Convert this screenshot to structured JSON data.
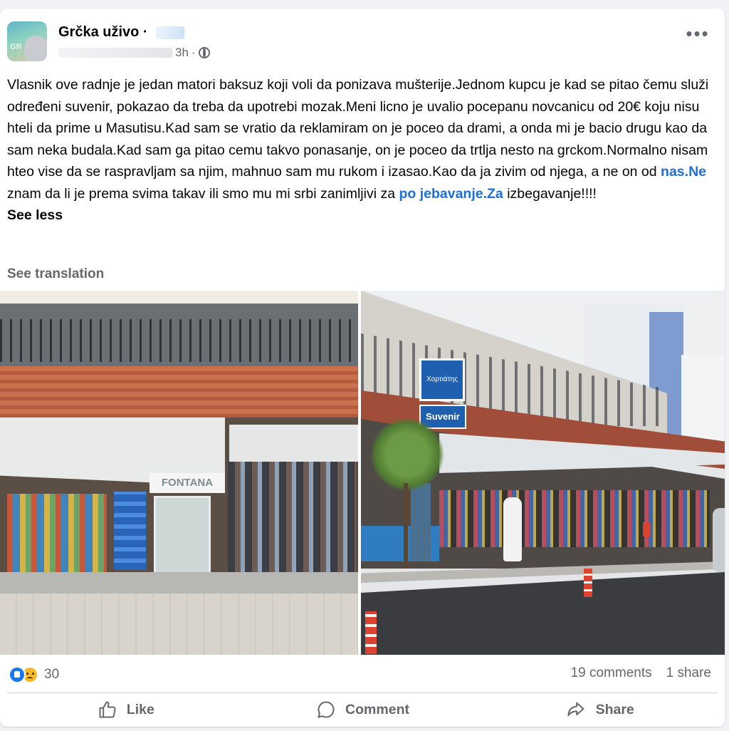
{
  "post": {
    "page_name": "Grčka uživo ·",
    "avatar_text": "GR",
    "time": "3h",
    "dot": "·",
    "more": "•••",
    "text_parts": {
      "p1": "Vlasnik ove radnje je jedan matori baksuz koji voli da ponizava mušterije.Jednom kupcu je kad se pitao čemu služi određeni suvenir, pokazao da treba da upotrebi mozak.Meni licno je uvalio pocepanu novcanicu od 20€ koju nisu hteli da prime u Masutisu.Kad sam se vratio da reklamiram on je poceo da drami, a onda mi je bacio drugu kao da sam neka budala.Kad sam ga pitao cemu takvo ponasanje, on je poceo da trtlja nesto na grckom.Normalno nisam hteo vise da se raspravljam sa njim, mahnuo sam mu rukom i izasao.Kao da ja zivim od njega, a ne on od ",
      "link1": "nas.Ne",
      "p2": " znam da li je prema svima takav ili smo mu mi srbi zanimljivi za ",
      "link2": "po jebavanje.Za",
      "p3": " izbegavanje!!!!",
      "see_less": "See less"
    },
    "see_translation": "See translation"
  },
  "photos": {
    "left_sign": "FONTANA",
    "right_sign_top": "Χορτιάτης",
    "right_sign_bottom": "Suvenir"
  },
  "engagement": {
    "reaction_count": "30",
    "comments": "19 comments",
    "shares": "1 share"
  },
  "actions": {
    "like": "Like",
    "comment": "Comment",
    "share": "Share"
  },
  "colors": {
    "link": "#1e6fd9",
    "secondary_text": "#65676b",
    "like_blue": "#1877f2"
  }
}
